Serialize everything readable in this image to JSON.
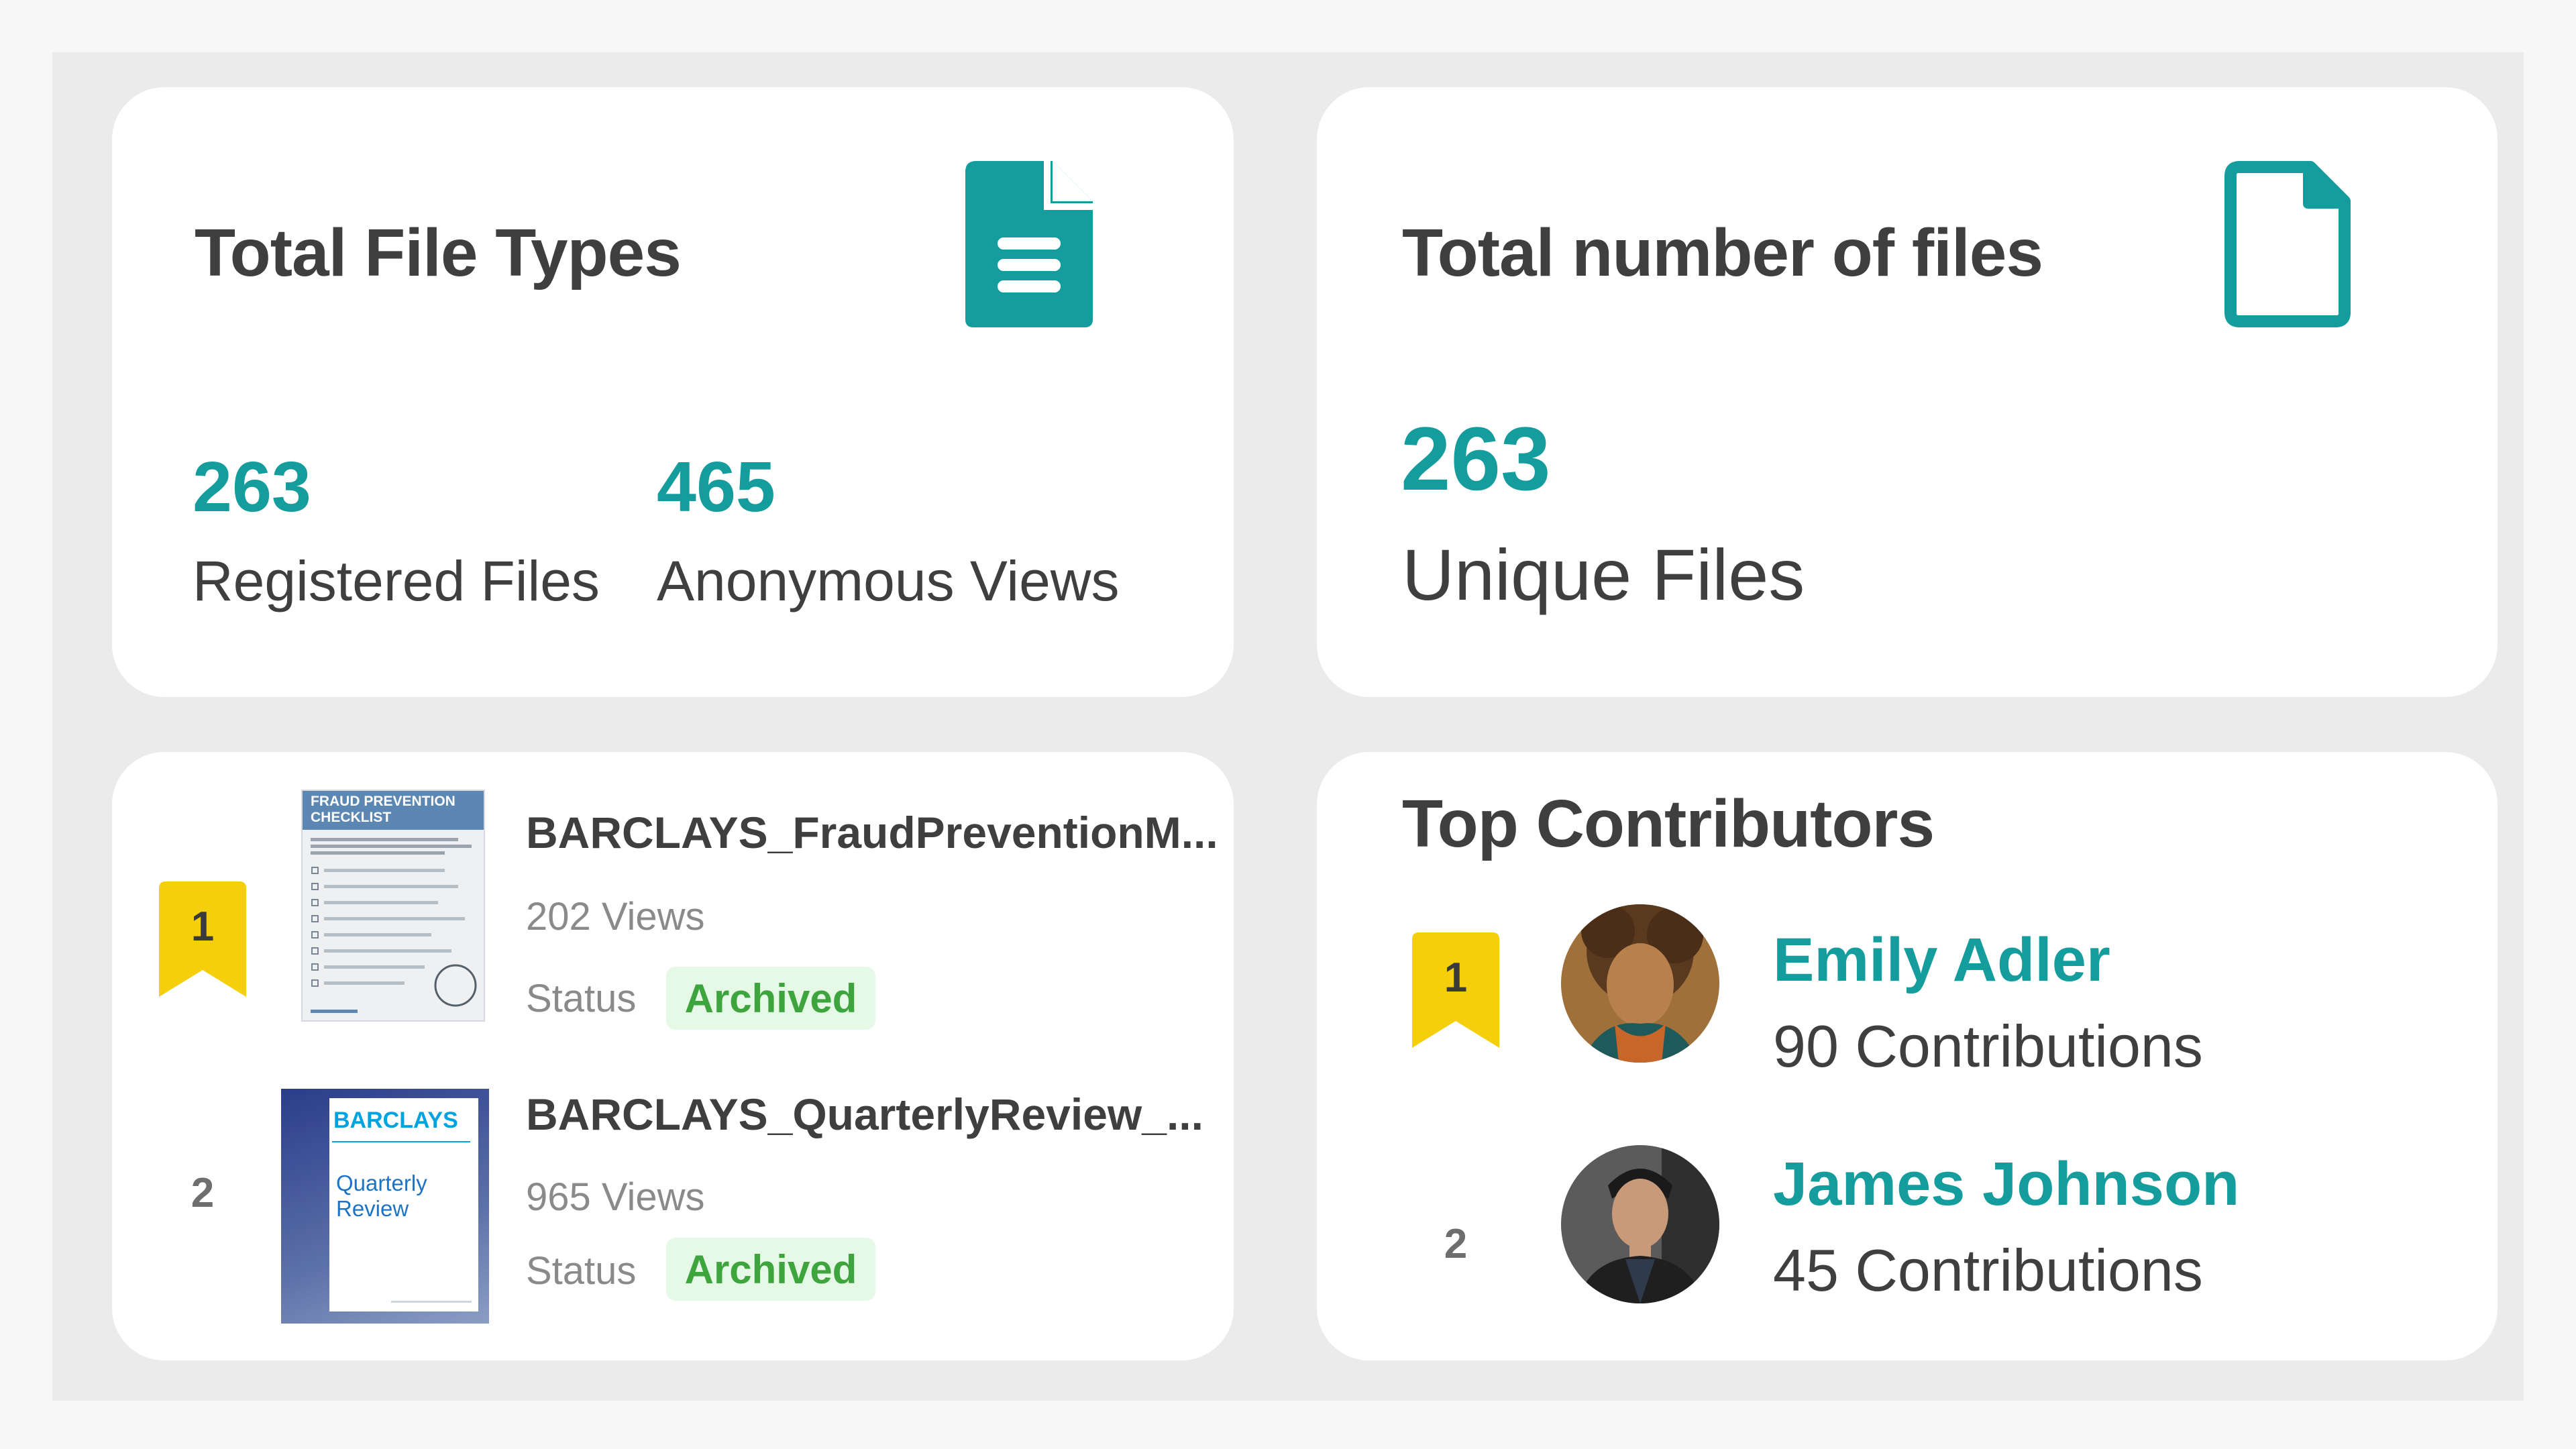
{
  "file_types_card": {
    "title": "Total File Types",
    "icon": "document-icon",
    "stats": [
      {
        "value": "263",
        "label": "Registered Files"
      },
      {
        "value": "465",
        "label": "Anonymous Views"
      }
    ]
  },
  "total_files_card": {
    "title": "Total number of files",
    "icon": "file-outline-icon",
    "value": "263",
    "label": "Unique Files"
  },
  "top_files_card": {
    "files": [
      {
        "rank": "1",
        "name": "BARCLAYS_FraudPreventionM...",
        "views": "202 Views",
        "status_label": "Status",
        "status": "Archived",
        "thumb_title": "FRAUD PREVENTION CHECKLIST"
      },
      {
        "rank": "2",
        "name": "BARCLAYS_QuarterlyReview_...",
        "views": "965 Views",
        "status_label": "Status",
        "status": "Archived",
        "thumb_brand": "BARCLAYS",
        "thumb_title": "Quarterly Review"
      }
    ]
  },
  "contributors_card": {
    "title": "Top Contributors",
    "contributors": [
      {
        "rank": "1",
        "name": "Emily Adler",
        "contributions": "90 Contributions"
      },
      {
        "rank": "2",
        "name": "James Johnson",
        "contributions": "45 Contributions"
      }
    ]
  },
  "colors": {
    "accent": "#159c9d",
    "gold": "#f5cf0c",
    "status_bg": "#e6f8e6",
    "status_text": "#3ea53e"
  }
}
